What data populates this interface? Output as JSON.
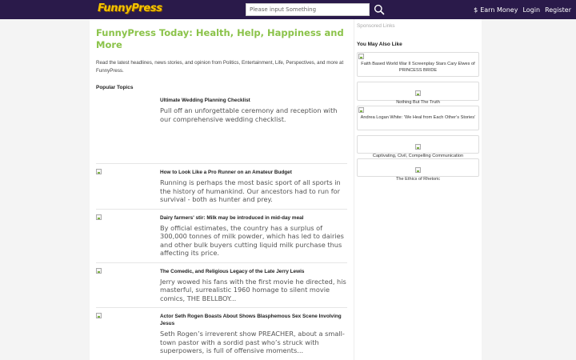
{
  "header": {
    "logo": "FunnyPress",
    "search_placeholder": "Please input Something",
    "nav": {
      "earn": "Earn Money",
      "dollar_icon": "$",
      "login": "Login",
      "register": "Register"
    },
    "colors": {
      "bar": "#2a1a4a",
      "logo": "#f5c400",
      "accent": "#8bc34a"
    }
  },
  "main": {
    "headline": "FunnyPress Today: Health, Help, Happiness and More",
    "intro": "Read the latest headlines, news stories, and opinion from Politics, Entertainment, Life, Perspectives, and more at FunnyPress.",
    "section_title": "Popular Topics",
    "articles": [
      {
        "title": "Ultimate Wedding Planning Checklist",
        "desc": "Pull off an unforgettable ceremony and reception with our comprehensive wedding checklist."
      },
      {
        "title": "How to Look Like a Pro Runner on an Amateur Budget",
        "desc": "Running is perhaps the most basic sport of all sports in the history of humankind. Our ancestors had to run for survival - both as hunter and prey."
      },
      {
        "title": "Dairy farmers' stir: Milk may be introduced in mid-day meal",
        "desc": "By official estimates, the country has a surplus of 300,000 tonnes of milk powder, which has led to dairies and other bulk buyers cutting liquid milk purchase thus affecting its price."
      },
      {
        "title": "The Comedic, and Religious Legacy of the Late Jerry Lewis",
        "desc": "Jerry wowed his fans with the first movie he directed, his masterful, surrealistic 1960 homage to silent movie comics, THE BELLBOY..."
      },
      {
        "title": "Actor Seth Rogen Boasts About Shows Blasphemous Sex Scene Involving Jesus",
        "desc": "Seth Rogen’s irreverent show PREACHER, about a small-town pastor with a sordid past who’s struck with superpowers, is full of offensive moments..."
      }
    ]
  },
  "sidebar": {
    "sponsored": "Sponsored Links",
    "also_title": "You May Also Like",
    "cards": [
      "Faith Based World War II Screenplay Stars Cary Elwes of PRINCESS BRIDE",
      "Nothing But The Truth",
      "Andrea Logan White: ‘We Heal from Each Other’s Stories’",
      "Captivating, Civil, Compelling Communication",
      "The Ethics of Rhetoric"
    ]
  }
}
